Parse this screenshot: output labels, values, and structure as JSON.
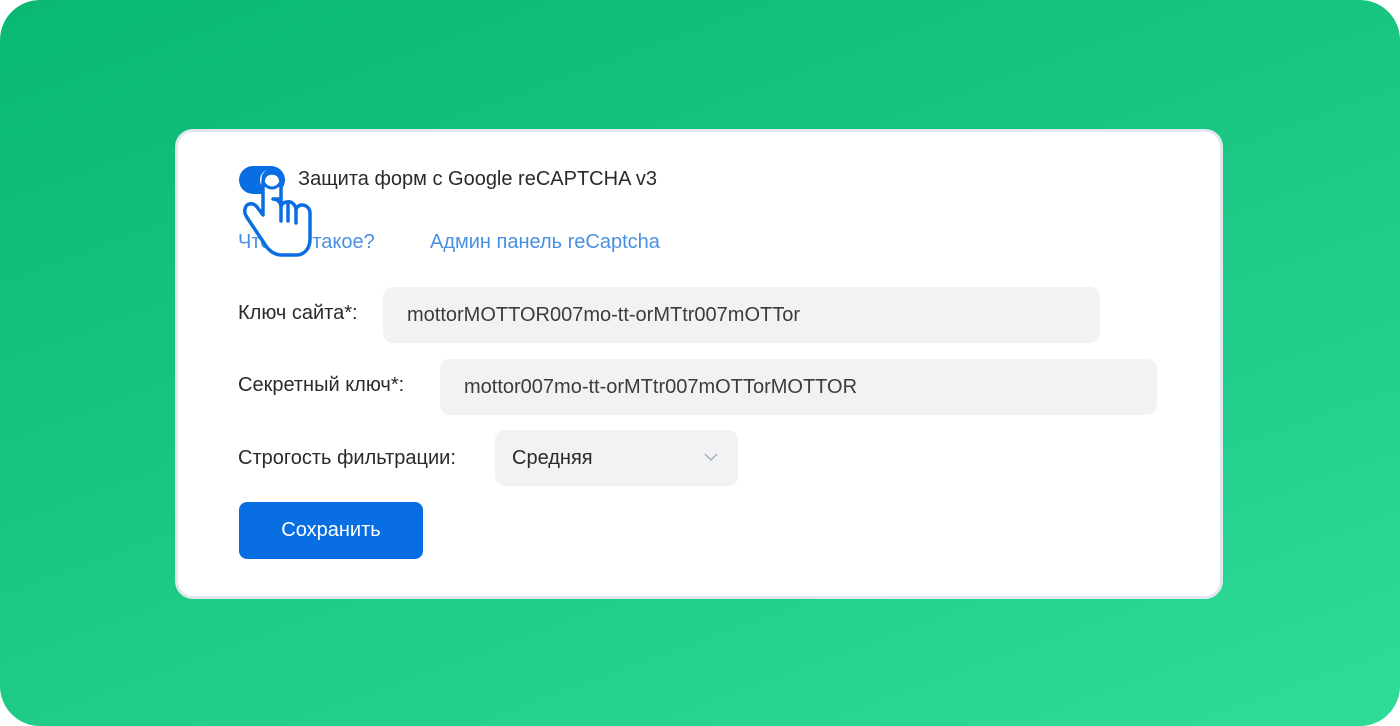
{
  "recaptcha": {
    "toggle_label": "Защита форм с Google reCAPTCHA v3",
    "toggle_on": true
  },
  "links": {
    "what_is_it": "Что это такое?",
    "admin_panel": "Админ панель reCaptcha"
  },
  "form": {
    "site_key_label": "Ключ сайта*:",
    "site_key_value": "mottorMOTTOR007mo-tt-orMTtr007mOTTor",
    "secret_key_label": "Секретный ключ*:",
    "secret_key_value": "mottor007mo-tt-orMTtr007mOTTorMOTTOR",
    "strictness_label": "Строгость фильтрации:",
    "strictness_value": "Средняя",
    "save_label": "Сохранить"
  },
  "colors": {
    "accent": "#0a6ee3",
    "link": "#4a90e2",
    "background_gradient_start": "#09b873",
    "background_gradient_end": "#2fdc98"
  },
  "icons": {
    "cursor": "hand-pointer-icon",
    "select_arrow": "chevron-down-icon"
  }
}
